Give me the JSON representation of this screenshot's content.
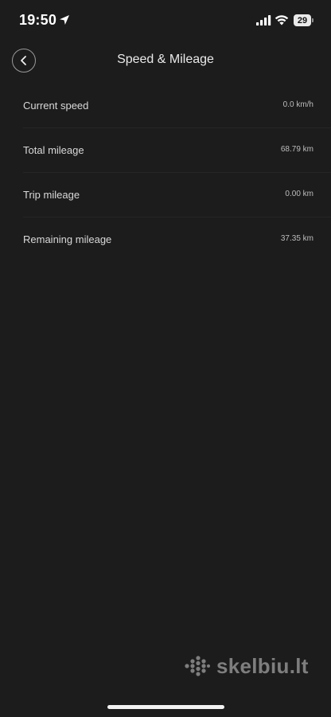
{
  "status_bar": {
    "time": "19:50",
    "battery_level": "29"
  },
  "header": {
    "title": "Speed & Mileage"
  },
  "items": [
    {
      "label": "Current speed",
      "value": "0.0 km/h"
    },
    {
      "label": "Total mileage",
      "value": "68.79 km"
    },
    {
      "label": "Trip mileage",
      "value": "0.00 km"
    },
    {
      "label": "Remaining mileage",
      "value": "37.35 km"
    }
  ],
  "watermark": {
    "text": "skelbiu.lt"
  },
  "icons": {
    "back": "chevron-left-icon",
    "location": "location-arrow-icon",
    "signal": "cellular-signal-icon",
    "wifi": "wifi-icon",
    "battery": "battery-icon"
  },
  "colors": {
    "background": "#1c1c1c",
    "text_primary": "#e6e6e6",
    "divider": "#262626"
  }
}
